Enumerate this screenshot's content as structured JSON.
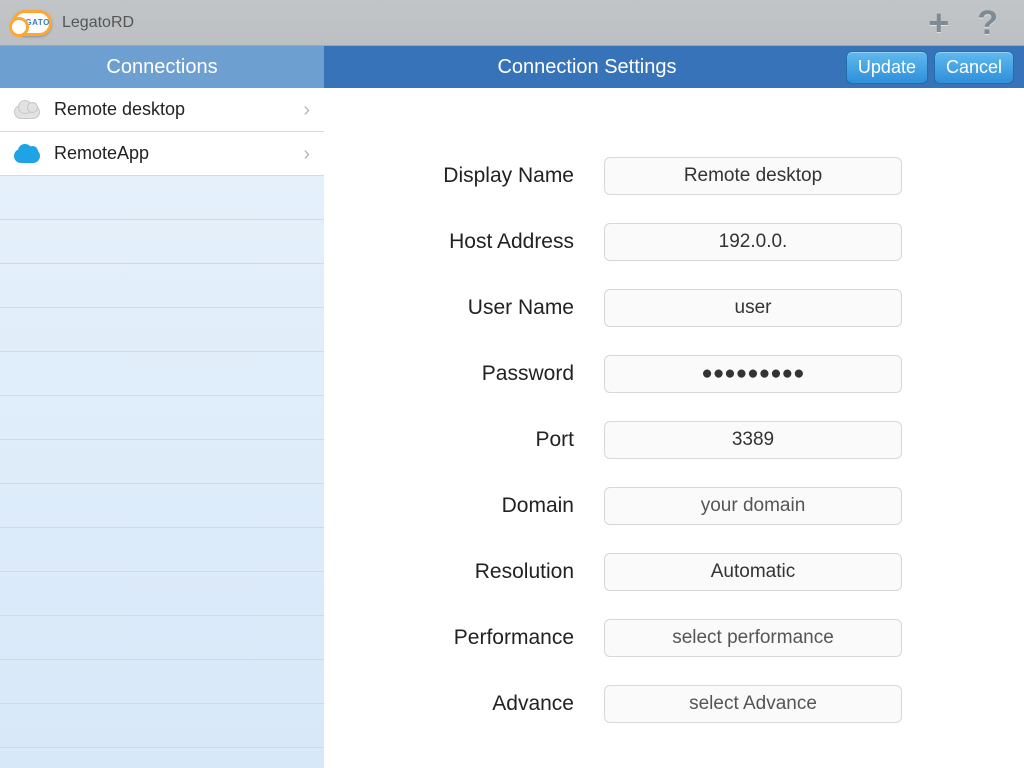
{
  "topbar": {
    "app_title": "LegatoRD",
    "logo_text": "LEGATO"
  },
  "sidebar": {
    "header": "Connections",
    "items": [
      {
        "label": "Remote desktop",
        "icon": "cloud-grey"
      },
      {
        "label": "RemoteApp",
        "icon": "cloud-blue"
      }
    ]
  },
  "main": {
    "header_title": "Connection Settings",
    "update_label": "Update",
    "cancel_label": "Cancel"
  },
  "form": {
    "display_name": {
      "label": "Display Name",
      "value": "Remote desktop"
    },
    "host_address": {
      "label": "Host Address",
      "value": "192.0.0."
    },
    "user_name": {
      "label": "User Name",
      "value": "user"
    },
    "password": {
      "label": "Password",
      "value": "●●●●●●●●●"
    },
    "port": {
      "label": "Port",
      "value": "3389"
    },
    "domain": {
      "label": "Domain",
      "value": "your domain"
    },
    "resolution": {
      "label": "Resolution",
      "value": "Automatic"
    },
    "performance": {
      "label": "Performance",
      "value": "select performance"
    },
    "advance": {
      "label": "Advance",
      "value": "select Advance"
    }
  }
}
